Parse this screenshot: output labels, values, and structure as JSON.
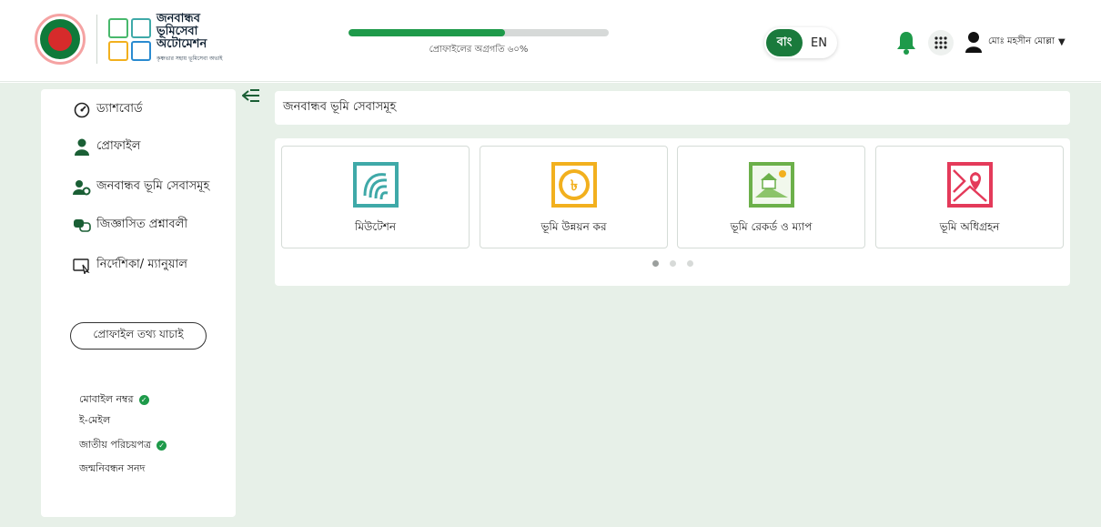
{
  "header": {
    "logo_title_lines": [
      "জনবান্ধব",
      "ভূমিসেবা",
      "অটোমেশন"
    ],
    "logo_tagline": "কৃষ্ণভার সহায় ভূমিসেবা অভাই",
    "progress_text": "প্রোফাইলের অগ্রগতি ৬০%",
    "progress_value": 60,
    "lang_bn": "বাং",
    "lang_en": "EN",
    "user_name": "মোঃ মহসীন মোল্লা",
    "icons": [
      "bell-icon",
      "apps-grid-icon",
      "user-icon",
      "caret-down-icon"
    ]
  },
  "sidebar": {
    "items": [
      {
        "label": "ড্যাশবোর্ড",
        "icon": "dashboard-icon"
      },
      {
        "label": "প্রোফাইল",
        "icon": "user-icon"
      },
      {
        "label": "জনবান্ধব ভূমি সেবাসমূহ",
        "icon": "user-settings-icon"
      },
      {
        "label": "জিজ্ঞাসিত প্রশ্নাবলী",
        "icon": "faq-icon"
      },
      {
        "label": "নির্দেশিকা/ ম্যানুয়াল",
        "icon": "guide-icon"
      }
    ],
    "verify_button": "প্রোফাইল তথ্য যাচাই",
    "checks": [
      {
        "label": "মোবাইল নম্বর",
        "verified": true
      },
      {
        "label": "ই-মেইল",
        "verified": false
      },
      {
        "label": "জাতীয় পরিচয়পত্র",
        "verified": true
      },
      {
        "label": "জন্মনিবন্ধন সনদ",
        "verified": false
      }
    ]
  },
  "main": {
    "title": "জনবান্ধব ভূমি সেবাসমূহ",
    "cards": [
      {
        "label": "মিউটেশন",
        "icon": "fingerprint-icon",
        "color": "#3fa9a8"
      },
      {
        "label": "ভূমি উন্নয়ন কর",
        "icon": "taka-icon",
        "color": "#f2b01e"
      },
      {
        "label": "ভূমি রেকর্ড ও ম্যাপ",
        "icon": "land-record-icon",
        "color": "#6cb04a"
      },
      {
        "label": "ভূমি অধিগ্রহন",
        "icon": "map-pin-icon",
        "color": "#e43a5a"
      }
    ],
    "carousel_pages": 3,
    "carousel_active": 1
  },
  "colors": {
    "brand_green": "#1a7a3c",
    "progress_green": "#1e9a4a",
    "content_bg": "#e7f0e8"
  }
}
